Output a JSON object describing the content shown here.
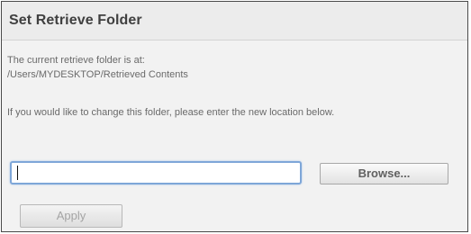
{
  "dialog": {
    "title": "Set Retrieve Folder",
    "current_label": "The current retrieve folder is at:",
    "current_path": "/Users/MYDESKTOP/Retrieved Contents",
    "instructions": "If you would like to change this folder, please enter the new location below.",
    "path_input": {
      "value": "",
      "placeholder": ""
    },
    "browse_label": "Browse...",
    "apply_label": "Apply"
  },
  "colors": {
    "panel_bg": "#ececec",
    "border": "#4a4a4a",
    "input_focus": "#7ea6d8",
    "title_text": "#404040",
    "body_text": "#6a6a6a"
  }
}
